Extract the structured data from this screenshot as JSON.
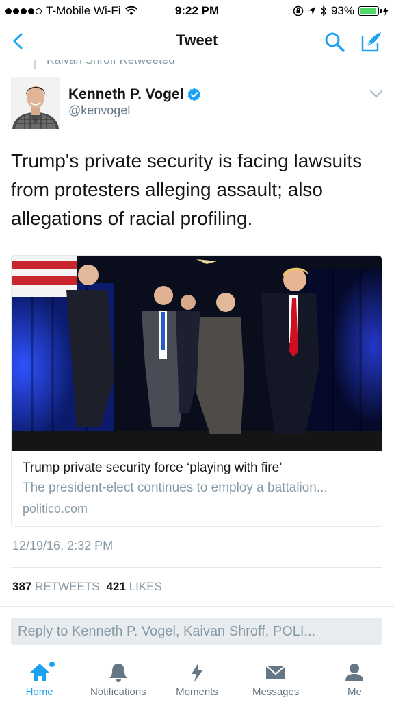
{
  "status_bar": {
    "carrier": "T-Mobile Wi-Fi",
    "time": "9:22 PM",
    "battery_percent": "93%",
    "battery_level": 0.93
  },
  "nav": {
    "title": "Tweet",
    "back_icon": "chevron-left-icon",
    "search_icon": "search-icon",
    "compose_icon": "compose-icon"
  },
  "retweet_context": {
    "text": "Kaivan Shroff Retweeted"
  },
  "tweet": {
    "author_name": "Kenneth P. Vogel",
    "author_handle": "@kenvogel",
    "verified": true,
    "text": "Trump's private security is facing lawsuits from protesters alleging assault; also allegations of racial profiling.",
    "timestamp": "12/19/16, 2:32 PM",
    "retweets_count": "387",
    "retweets_label": "RETWEETS",
    "likes_count": "421",
    "likes_label": "LIKES"
  },
  "card": {
    "title": "Trump private security force ‘playing with fire’",
    "description": "The president-elect continues to employ a battalion...",
    "domain": "politico.com"
  },
  "reply": {
    "placeholder": "Reply to Kenneth P. Vogel, Kaivan Shroff, POLI..."
  },
  "tab_bar": {
    "tabs": [
      {
        "label": "Home",
        "icon": "home-icon",
        "active": true
      },
      {
        "label": "Notifications",
        "icon": "bell-icon",
        "active": false
      },
      {
        "label": "Moments",
        "icon": "lightning-icon",
        "active": false
      },
      {
        "label": "Messages",
        "icon": "envelope-icon",
        "active": false
      },
      {
        "label": "Me",
        "icon": "person-icon",
        "active": false
      }
    ]
  },
  "colors": {
    "accent": "#1da1f2",
    "text_primary": "#14171a",
    "text_secondary": "#8899a6",
    "battery": "#4cd964"
  }
}
